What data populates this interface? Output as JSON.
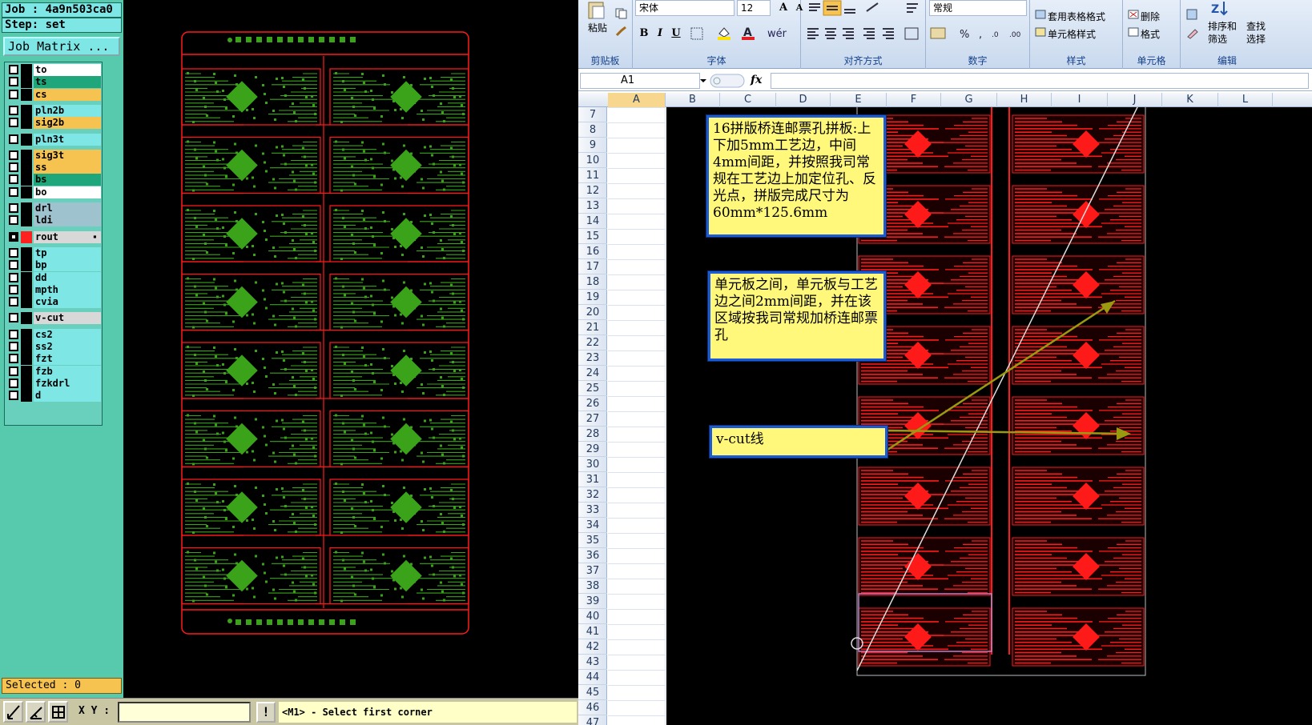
{
  "cam": {
    "job_label": "Job : 4a9n503ca0",
    "step_label": "Step: set",
    "job_matrix_label": "Job Matrix ...",
    "layers": [
      {
        "name": "to",
        "color": "#ffffff"
      },
      {
        "name": "ts",
        "color": "#1fa67a"
      },
      {
        "name": "cs",
        "color": "#f6c350"
      },
      {
        "name": "pln2b",
        "color": "#7fe6e6"
      },
      {
        "name": "sig2b",
        "color": "#f6c350"
      },
      {
        "name": "pln3t",
        "color": "#7fe6e6"
      },
      {
        "name": "sig3t",
        "color": "#f6c350"
      },
      {
        "name": "ss",
        "color": "#f6c350"
      },
      {
        "name": "bs",
        "color": "#1fa67a"
      },
      {
        "name": "bo",
        "color": "#ffffff"
      },
      {
        "name": "drl",
        "color": "#9fc2cf"
      },
      {
        "name": "ldi",
        "color": "#9fc2cf"
      },
      {
        "name": "rout",
        "color": "#d8d8d8"
      },
      {
        "name": "tp",
        "color": "#7fe6e6"
      },
      {
        "name": "bp",
        "color": "#7fe6e6"
      },
      {
        "name": "dd",
        "color": "#7fe6e6"
      },
      {
        "name": "mpth",
        "color": "#7fe6e6"
      },
      {
        "name": "cvia",
        "color": "#7fe6e6"
      },
      {
        "name": "v-cut",
        "color": "#d8d8d8"
      },
      {
        "name": "cs2",
        "color": "#7fe6e6"
      },
      {
        "name": "ss2",
        "color": "#7fe6e6"
      },
      {
        "name": "fzt",
        "color": "#7fe6e6"
      },
      {
        "name": "fzb",
        "color": "#7fe6e6"
      },
      {
        "name": "fzkdrl",
        "color": "#7fe6e6"
      },
      {
        "name": "d",
        "color": "#7fe6e6"
      }
    ],
    "selected_label": "Selected : 0",
    "xy_label": "X Y :",
    "warn_glyph": "!",
    "status_message": "<M1> - Select first corner",
    "pcb_trace_color": "#3aa31a",
    "outline_color": "#ff1a1a"
  },
  "excel": {
    "ribbon": {
      "paste_label": "粘贴",
      "clipboard_group": "剪贴板",
      "font_name": "宋体",
      "font_size": "12",
      "font_group": "字体",
      "align_group": "对齐方式",
      "number_format": "常规",
      "number_group": "数字",
      "table_format_label": "套用表格格式",
      "cell_style_label": "单元格样式",
      "styles_group": "样式",
      "delete_label": "删除",
      "format_label": "格式",
      "cells_group": "单元格",
      "sort_filter_label": "排序和",
      "sort_filter_label2": "筛选",
      "find_select_label": "查找",
      "find_select_label2": "选择",
      "editing_group": "编辑"
    },
    "name_box": "A1",
    "fx_label": "fx",
    "columns": [
      "A",
      "B",
      "C",
      "D",
      "E",
      "F",
      "G",
      "H",
      "I",
      "J",
      "K",
      "L"
    ],
    "rows": [
      "7",
      "8",
      "9",
      "10",
      "11",
      "12",
      "13",
      "14",
      "15",
      "16",
      "17",
      "18",
      "19",
      "20",
      "21",
      "22",
      "23",
      "24",
      "25",
      "26",
      "27",
      "28",
      "29",
      "30",
      "31",
      "32",
      "33",
      "34",
      "35",
      "36",
      "37",
      "38",
      "39",
      "40",
      "41",
      "42",
      "43",
      "44",
      "45",
      "46",
      "47"
    ],
    "notes": {
      "note1": "16拼版桥连邮票孔拼板:上下加5mm工艺边，中间4mm间距，并按照我司常规在工艺边上加定位孔、反光点，拼版完成尺寸为60mm*125.6mm",
      "note2": "单元板之间，单元板与工艺边之间2mm间距，并在该区域按我司常规加桥连邮票孔",
      "note3": "v-cut线"
    },
    "pcb_color": "#ff1a1a",
    "arrow_color": "#9a9a10"
  }
}
